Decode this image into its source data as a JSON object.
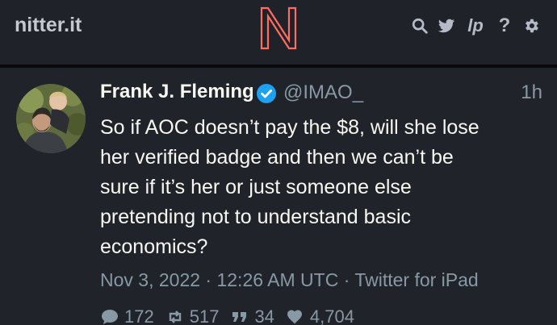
{
  "navbar": {
    "brand": "nitter.it",
    "logo_letter": "N",
    "icons": [
      "search-icon",
      "twitter-bird-icon",
      "liberapay-icon",
      "help-icon",
      "gear-icon"
    ],
    "lp_label": "lp",
    "help_label": "?"
  },
  "tweet": {
    "fullname": "Frank J. Fleming",
    "username": "@IMAO_",
    "date": "1h",
    "content": "So if AOC doesn’t pay the $8, will she lose\nher verified badge and then we can’t be\nsure if it’s her or just someone else\npretending not to understand basic\neconomics?",
    "published": "Nov 3, 2022 · 12:26 AM UTC · Twitter for iPad",
    "stats": {
      "comments": "172",
      "retweets": "517",
      "quotes": "34",
      "likes": "4,704"
    }
  },
  "colors": {
    "navbar_bg": "#1f2229",
    "tweet_bg": "#20232a",
    "logo_accent": "#ff6c60",
    "verified_badge": "#1da1f2",
    "secondary_text": "#8899a6"
  }
}
